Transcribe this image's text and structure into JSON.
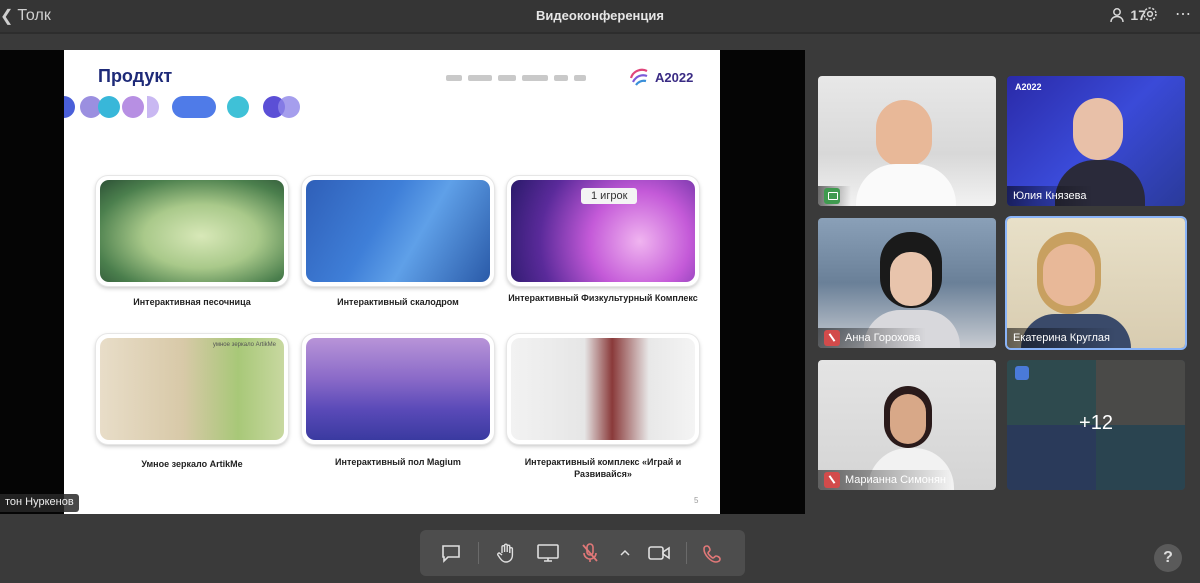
{
  "header": {
    "back_label": "Толк",
    "title": "Видеоконференция",
    "participant_count": "17"
  },
  "slide": {
    "title": "Продукт",
    "brand": "А2022",
    "page_number": "5",
    "cards": [
      {
        "caption": "Интерактивная песочница"
      },
      {
        "caption": "Интерактивный скалодром"
      },
      {
        "caption": "Интерактивный Физкультурный Комплекс"
      },
      {
        "caption": "Умное зеркало ArtikMe"
      },
      {
        "caption": "Интерактивный пол Magium"
      },
      {
        "caption": "Интерактивный комплекс «Играй и Развивайся»"
      }
    ],
    "card3_overlay": "1 игрок",
    "card4_overlay": "умное зеркало ArtikMe"
  },
  "speaker_label": "тон Нуркенов",
  "participants": [
    {
      "name": ""
    },
    {
      "name": "Юлия Князева",
      "overlay": "А2022"
    },
    {
      "name": "Анна Горохова"
    },
    {
      "name": "Екатерина Круглая"
    },
    {
      "name": "Марианна Симонян"
    },
    {
      "name": "",
      "more": "+12"
    }
  ],
  "help_label": "?",
  "colors": {
    "accent_active": "#8ab4f8",
    "mic_off": "#d24b4b",
    "screen_share": "#3f9a4f",
    "slide_title": "#1e2a78"
  },
  "icons": [
    "chevron-left-icon",
    "participants-icon",
    "gear-icon",
    "more-icon",
    "chat-icon",
    "hand-icon",
    "screen-share-icon",
    "mic-off-icon",
    "chevron-up-icon",
    "camera-icon",
    "hangup-icon",
    "help-icon"
  ]
}
